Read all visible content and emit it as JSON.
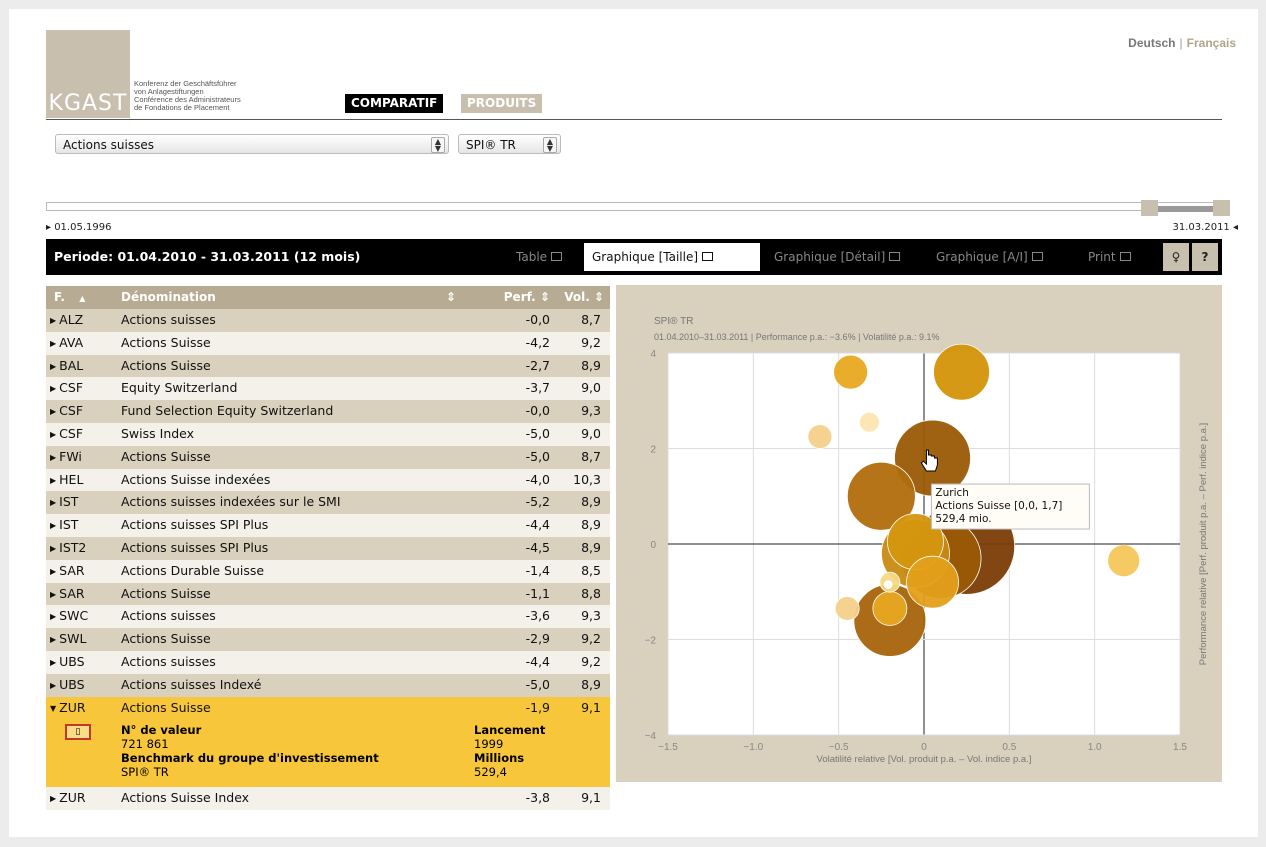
{
  "header": {
    "logo_letters": "KGAST",
    "logo_lines": [
      "Konferenz der Geschäftsführer",
      "von Anlagestiftungen",
      "Conférence des Administrateurs",
      "de Fondations de Placement"
    ],
    "nav_comparatif": "COMPARATIF",
    "nav_produits": "PRODUITS",
    "lang_de": "Deutsch",
    "lang_sep": "|",
    "lang_fr": "Français"
  },
  "filters": {
    "category": "Actions suisses",
    "benchmark": "SPI® TR"
  },
  "timeline": {
    "start": "▸ 01.05.1996",
    "end": "31.03.2011 ◂"
  },
  "period": {
    "label": "Periode: 01.04.2010 - 31.03.2011 (12 mois)",
    "tabs": [
      "Table",
      "Graphique [Taille]",
      "Graphique [Détail]",
      "Graphique [A/I]",
      "Print"
    ],
    "active_tab": "Graphique [Taille]",
    "help_label": "?"
  },
  "table": {
    "headers": {
      "f": "F.",
      "name": "Dénomination",
      "perf": "Perf.",
      "vol": "Vol."
    },
    "rows": [
      {
        "code": "ALZ",
        "name": "Actions suisses",
        "perf": "-0,0",
        "vol": "8,7"
      },
      {
        "code": "AVA",
        "name": "Actions Suisse",
        "perf": "-4,2",
        "vol": "9,2"
      },
      {
        "code": "BAL",
        "name": "Actions Suisse",
        "perf": "-2,7",
        "vol": "8,9"
      },
      {
        "code": "CSF",
        "name": "Equity Switzerland",
        "perf": "-3,7",
        "vol": "9,0"
      },
      {
        "code": "CSF",
        "name": "Fund Selection Equity Switzerland",
        "perf": "-0,0",
        "vol": "9,3"
      },
      {
        "code": "CSF",
        "name": "Swiss Index",
        "perf": "-5,0",
        "vol": "9,0"
      },
      {
        "code": "FWi",
        "name": "Actions Suisse",
        "perf": "-5,0",
        "vol": "8,7"
      },
      {
        "code": "HEL",
        "name": "Actions Suisse indexées",
        "perf": "-4,0",
        "vol": "10,3"
      },
      {
        "code": "IST",
        "name": "Actions suisses indexées sur le SMI",
        "perf": "-5,2",
        "vol": "8,9"
      },
      {
        "code": "IST",
        "name": "Actions suisses SPI Plus",
        "perf": "-4,4",
        "vol": "8,9"
      },
      {
        "code": "IST2",
        "name": "Actions suisses SPI Plus",
        "perf": "-4,5",
        "vol": "8,9"
      },
      {
        "code": "SAR",
        "name": "Actions Durable Suisse",
        "perf": "-1,4",
        "vol": "8,5"
      },
      {
        "code": "SAR",
        "name": "Actions Suisse",
        "perf": "-1,1",
        "vol": "8,8"
      },
      {
        "code": "SWC",
        "name": "Actions suisses",
        "perf": "-3,6",
        "vol": "9,3"
      },
      {
        "code": "SWL",
        "name": "Actions Suisse",
        "perf": "-2,9",
        "vol": "9,2"
      },
      {
        "code": "UBS",
        "name": "Actions suisses",
        "perf": "-4,4",
        "vol": "9,2"
      },
      {
        "code": "UBS",
        "name": "Actions suisses Indexé",
        "perf": "-5,0",
        "vol": "8,9"
      },
      {
        "code": "ZUR",
        "name": "Actions Suisse",
        "perf": "-1,9",
        "vol": "9,1",
        "selected": true
      }
    ],
    "detail": {
      "valeur_label": "N° de valeur",
      "valeur": "721 861",
      "benchmark_label": "Benchmark du groupe d'investissement",
      "benchmark": "SPI® TR",
      "lancement_label": "Lancement",
      "lancement": "1999",
      "millions_label": "Millions",
      "millions": "529,4"
    },
    "last_row": {
      "code": "ZUR",
      "name": "Actions Suisse Index",
      "perf": "-3,8",
      "vol": "9,1"
    }
  },
  "chart_data": {
    "type": "scatter",
    "title": "SPI® TR",
    "subtitle": "01.04.2010–31.03.2011 | Performance p.a.: −3.6% | Volatilité p.a.: 9.1%",
    "xlabel": "Volatilité relative [Vol. produit p.a. – Vol. indice p.a.]",
    "ylabel": "Performance relative [Perf. produit p.a. – Perf. indice p.a.]",
    "xlim": [
      -1.5,
      1.5
    ],
    "ylim": [
      -4,
      4
    ],
    "xticks": [
      "−1.5",
      "−1.0",
      "−0.5",
      "0",
      "0.5",
      "1.0",
      "1.5"
    ],
    "yticks": [
      "4",
      "2",
      "0",
      "−2",
      "−4"
    ],
    "xtick_values": [
      -1.5,
      -1.0,
      -0.5,
      0,
      0.5,
      1.0,
      1.5
    ],
    "ytick_values": [
      4,
      2,
      0,
      -2,
      -4
    ],
    "grid": true,
    "bubble_size": "assets (mio.)",
    "points": [
      {
        "x": 0.05,
        "y": 1.8,
        "r": 38,
        "color": "#9a5a06"
      },
      {
        "x": 0.25,
        "y": -0.05,
        "r": 48,
        "color": "#7a3c05"
      },
      {
        "x": 0.1,
        "y": -0.3,
        "r": 40,
        "color": "#9a5a06"
      },
      {
        "x": -0.25,
        "y": 1.0,
        "r": 34,
        "color": "#b06d0b"
      },
      {
        "x": -0.2,
        "y": -1.6,
        "r": 36,
        "color": "#a86309"
      },
      {
        "x": -0.05,
        "y": -0.2,
        "r": 34,
        "color": "#c98a12"
      },
      {
        "x": -0.05,
        "y": 0.05,
        "r": 28,
        "color": "#d4960f"
      },
      {
        "x": 0.05,
        "y": -0.8,
        "r": 26,
        "color": "#e39f1a"
      },
      {
        "x": -0.2,
        "y": -1.35,
        "r": 17,
        "color": "#e8a820"
      },
      {
        "x": -0.2,
        "y": -0.8,
        "r": 10,
        "color": "#f5d985"
      },
      {
        "x": 0.22,
        "y": 3.6,
        "r": 28,
        "color": "#d4940a"
      },
      {
        "x": -0.43,
        "y": 3.6,
        "r": 17,
        "color": "#e8a820"
      },
      {
        "x": -0.32,
        "y": 2.55,
        "r": 10,
        "color": "#fbe5b0"
      },
      {
        "x": -0.61,
        "y": 2.25,
        "r": 12,
        "color": "#f6d08b"
      },
      {
        "x": -0.45,
        "y": -1.35,
        "r": 12,
        "color": "#f6d08b"
      },
      {
        "x": 1.17,
        "y": -0.35,
        "r": 16,
        "color": "#f6c75a"
      },
      {
        "x": -0.21,
        "y": -0.85,
        "r": 4,
        "color": "#ffffff"
      }
    ],
    "tooltip": {
      "lines": [
        "Zurich",
        "Actions Suisse [0,0, 1,7]",
        "529,4 mio."
      ],
      "x": 0.02,
      "y": 1.8
    }
  }
}
